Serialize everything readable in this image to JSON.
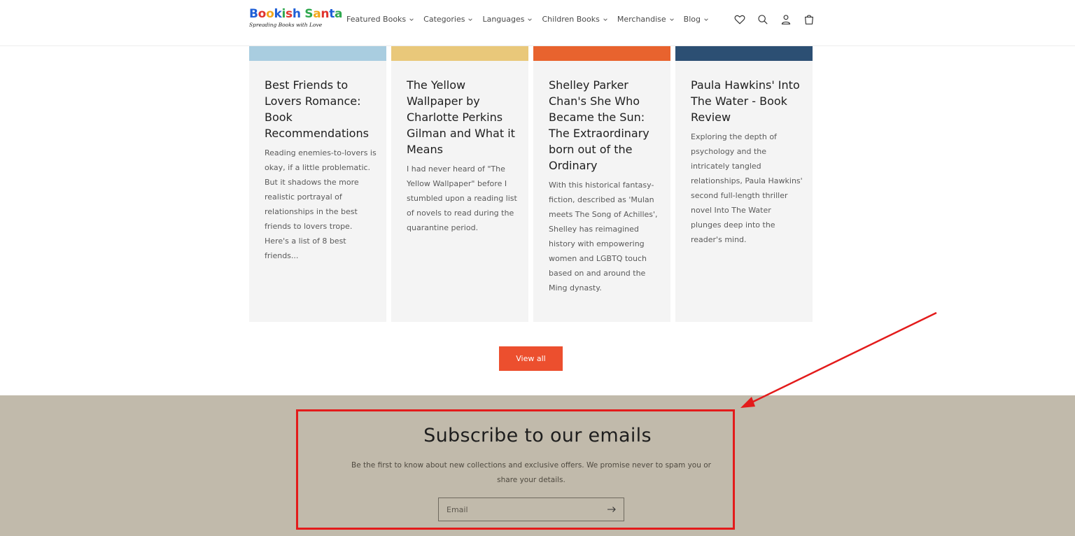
{
  "header": {
    "logo": {
      "title_letters": [
        {
          "ch": "B",
          "color": "#1f5fd6"
        },
        {
          "ch": "o",
          "color": "#e0332c"
        },
        {
          "ch": "o",
          "color": "#f2a71b"
        },
        {
          "ch": "k",
          "color": "#1f5fd6"
        },
        {
          "ch": "i",
          "color": "#2fa84f"
        },
        {
          "ch": "s",
          "color": "#e0332c"
        },
        {
          "ch": "h",
          "color": "#1f5fd6"
        },
        {
          "ch": " ",
          "color": "#000000"
        },
        {
          "ch": "S",
          "color": "#2fa84f"
        },
        {
          "ch": "a",
          "color": "#f2a71b"
        },
        {
          "ch": "n",
          "color": "#e0332c"
        },
        {
          "ch": "t",
          "color": "#1f5fd6"
        },
        {
          "ch": "a",
          "color": "#2fa84f"
        }
      ],
      "tagline": "Spreading Books with Love"
    },
    "nav": [
      {
        "label": "Featured Books"
      },
      {
        "label": "Categories"
      },
      {
        "label": "Languages"
      },
      {
        "label": "Children Books"
      },
      {
        "label": "Merchandise"
      },
      {
        "label": "Blog"
      }
    ],
    "icons": [
      "heart-icon",
      "search-icon",
      "account-icon",
      "cart-icon"
    ]
  },
  "cards": [
    {
      "title": "Best Friends to Lovers Romance: Book Recommendations",
      "excerpt": "Reading enemies-to-lovers is okay, if a little problematic. But it shadows the more realistic portrayal of relationships in the best friends to lovers trope. Here's a list of 8 best friends...",
      "thumb_color": "#a9cde0"
    },
    {
      "title": "The Yellow Wallpaper by Charlotte Perkins Gilman and What it Means",
      "excerpt": "I had never heard of \"The Yellow Wallpaper\" before I stumbled upon a reading list of novels to read during the quarantine period.",
      "thumb_color": "#e9c87a"
    },
    {
      "title": "Shelley Parker Chan's She Who Became the Sun: The Extraordinary born out of the Ordinary",
      "excerpt": "With this historical fantasy-fiction, described as 'Mulan meets The Song of Achilles', Shelley has reimagined history with empowering women and LGBTQ touch based on and around the Ming dynasty.",
      "thumb_color": "#e8632e"
    },
    {
      "title": "Paula Hawkins' Into The Water - Book Review",
      "excerpt": "Exploring the depth of psychology and the intricately tangled relationships, Paula Hawkins' second full-length thriller novel Into The Water plunges deep into the reader's mind.",
      "thumb_color": "#2c4f73"
    }
  ],
  "view_all_label": "View all",
  "newsletter": {
    "title": "Subscribe to our emails",
    "description": "Be the first to know about new collections and exclusive offers. We promise never to spam you or share your details.",
    "email_placeholder": "Email"
  },
  "colors": {
    "accent": "#ec4f2e",
    "newsletter_bg": "#c1baab",
    "annotation": "#e31b1b"
  }
}
